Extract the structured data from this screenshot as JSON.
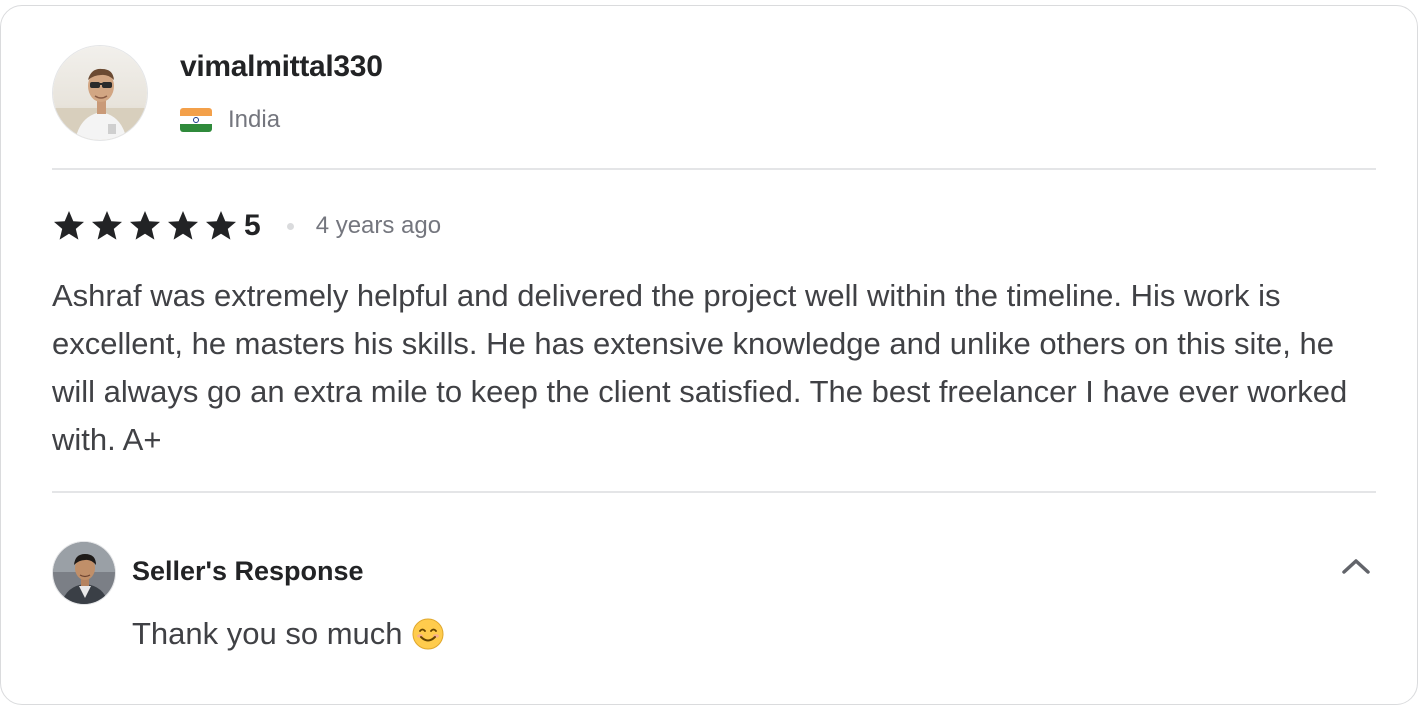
{
  "reviewer": {
    "username": "vimalmittal330",
    "country": "India",
    "flag_icon": "india-flag-icon"
  },
  "review": {
    "rating": "5",
    "stars_filled": 5,
    "stars_total": 5,
    "time_ago": "4 years ago",
    "text": "Ashraf was extremely helpful and delivered the project well within the timeline. His work is excellent, he masters his skills. He has extensive knowledge and unlike others on this site, he will always go an extra mile to keep the client satisfied. The best freelancer I have ever worked with. A+"
  },
  "seller_response": {
    "title": "Seller's Response",
    "text": "Thank you so much",
    "emoji_icon": "smiling-face-icon",
    "toggle_icon": "chevron-up-icon"
  },
  "colors": {
    "text_dark": "#222325",
    "text_body": "#404145",
    "text_muted": "#74767e",
    "border": "#dadbdd",
    "star": "#222325"
  }
}
